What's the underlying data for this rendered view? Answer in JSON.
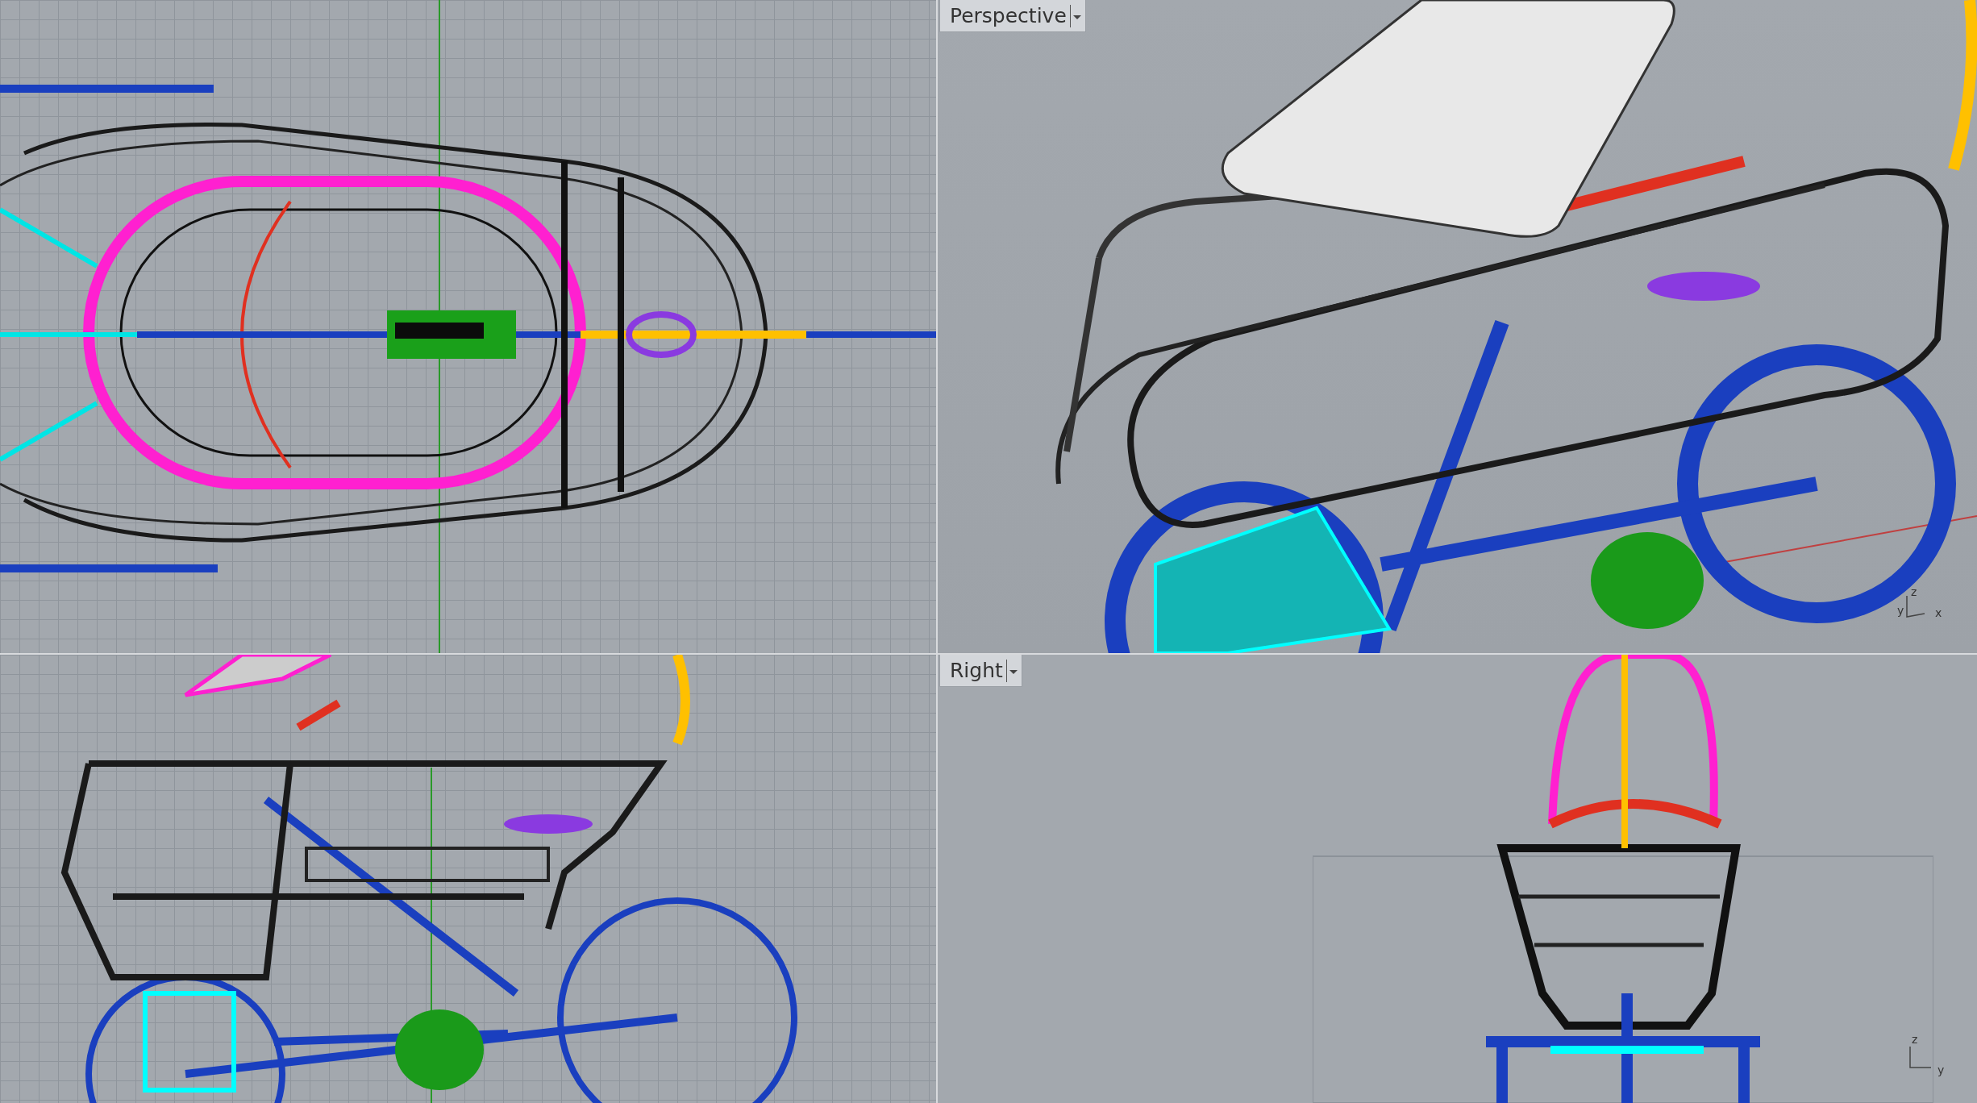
{
  "viewports": [
    {
      "kind": "top"
    },
    {
      "kind": "perspective",
      "label": "Perspective",
      "axes": [
        "z",
        "y",
        "x"
      ]
    },
    {
      "kind": "front"
    },
    {
      "kind": "right",
      "label": "Right",
      "axes": [
        "z",
        "y"
      ]
    }
  ]
}
